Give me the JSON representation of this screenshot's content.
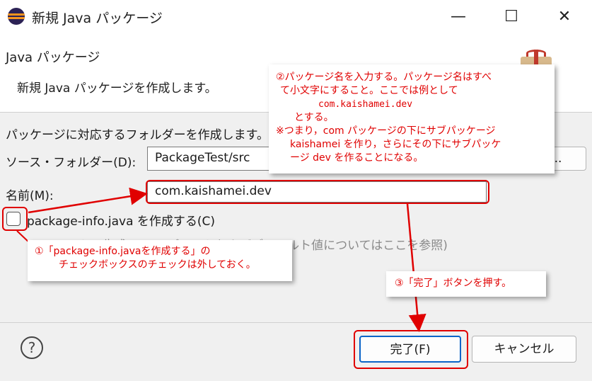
{
  "window": {
    "title": "新規 Java パッケージ",
    "minimize_glyph": "—",
    "maximize_glyph": "☐",
    "close_glyph": "✕"
  },
  "header": {
    "title": "Java パッケージ",
    "description": "新規 Java パッケージを作成します。"
  },
  "form": {
    "info_text": "パッケージに対応するフォルダーを作成します。",
    "source_folder_label": "ソース・フォルダー(D):",
    "source_folder_value": "PackageTest/src",
    "browse_button_label": "参照(O)...",
    "name_label": "名前(M):",
    "name_value": "com.kaishamei.dev",
    "checkbox_label": "package-info.java を作成する(C)",
    "checkbox_checked": false,
    "comment_hint_text": "コメントの生成の(テンプレートおよびデフォルト値についてはここを参照)"
  },
  "footer": {
    "finish_button_label": "完了(F)",
    "cancel_button_label": "キャンセル"
  },
  "annotations": {
    "callout2_lines": [
      "②パッケージ名を入力する。パッケージ名はすべ",
      "て小文字にすること。ここでは例として",
      "com.kaishamei.dev",
      "とする。",
      "※つまり，com パッケージの下にサブパッケージ",
      "kaishamei を作り，さらにその下にサブパッケ",
      "ージ dev を作ることになる。"
    ],
    "callout1_lines": [
      "①「package-info.javaを作成する」の",
      "チェックボックスのチェックは外しておく。"
    ],
    "callout3_text": "③「完了」ボタンを押す。",
    "annotation_color": "#e00000"
  }
}
